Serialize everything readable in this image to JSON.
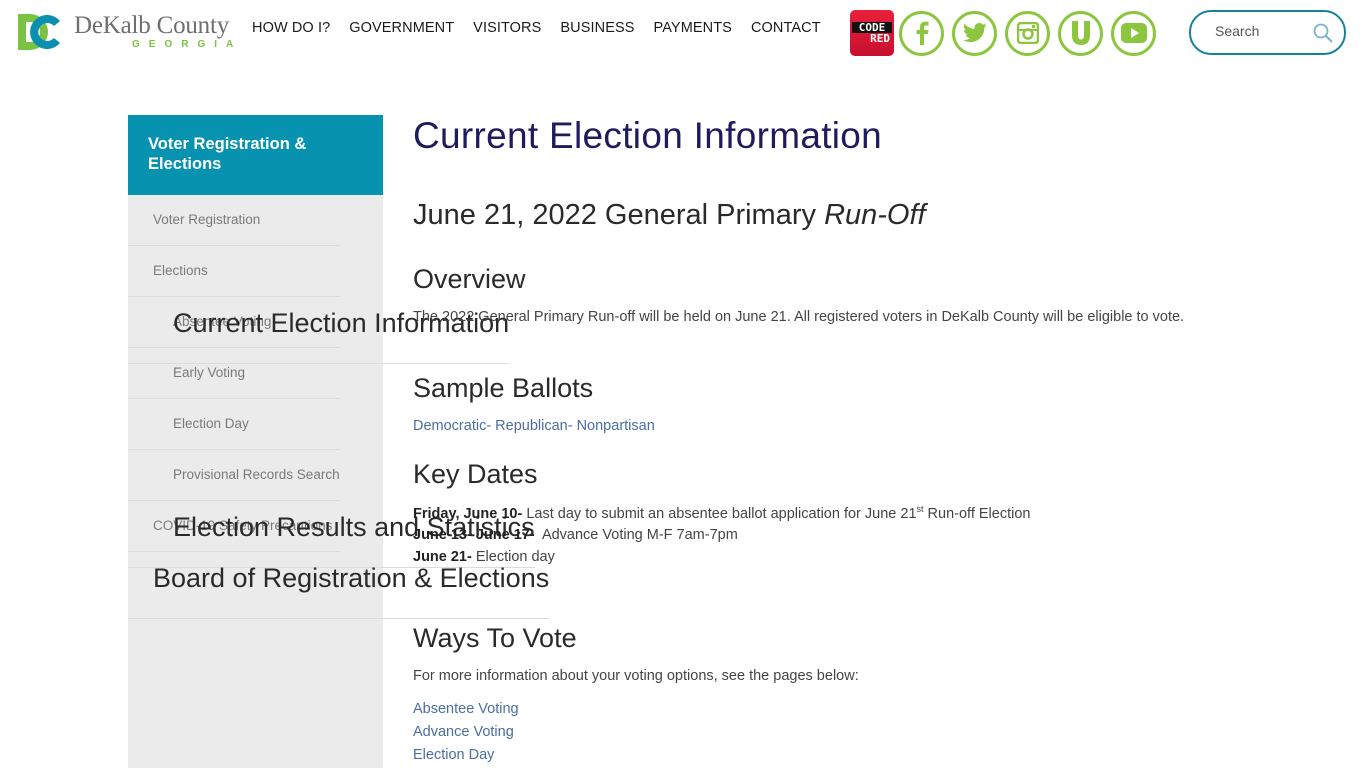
{
  "header": {
    "logo": {
      "name": "DeKalb County",
      "sub": "GEORGIA",
      "mark": "DC"
    },
    "nav": [
      "HOW DO I?",
      "GOVERNMENT",
      "VISITORS",
      "BUSINESS",
      "PAYMENTS",
      "CONTACT"
    ],
    "codered": {
      "top": "CODE",
      "bottom": "RED"
    },
    "social": [
      "facebook-icon",
      "twitter-icon",
      "instagram-icon",
      "u-icon",
      "youtube-icon"
    ],
    "search": {
      "placeholder": "Search",
      "value": ""
    }
  },
  "colors": {
    "brand_green": "#8cc63f",
    "brand_teal": "#0792b0",
    "title_navy": "#1f1c5e",
    "link_blue": "#4a6fa0"
  },
  "sidebar": {
    "heading": "Voter Registration & Elections",
    "items": [
      {
        "label": "Voter Registration",
        "level": 1
      },
      {
        "label": "Elections",
        "level": 1
      },
      {
        "label": "Current Election Information",
        "level": 2
      },
      {
        "label": "Absentee Voting",
        "level": 2
      },
      {
        "label": "Early Voting",
        "level": 2
      },
      {
        "label": "Election Day",
        "level": 2
      },
      {
        "label": "Provisional Records Search",
        "level": 2
      },
      {
        "label": "Election Results and Statistics",
        "level": 2
      },
      {
        "label": "COVID-19 Safety Precautions",
        "level": 1
      },
      {
        "label": "Board of Registration & Elections",
        "level": 1
      }
    ]
  },
  "main": {
    "title": "Current Election Information",
    "election_heading": {
      "text": "June 21, 2022 General Primary ",
      "emphasis": "Run-Off"
    },
    "overview": {
      "heading": "Overview",
      "text": "The 2022 General Primary Run-off  will be held on June 21. All registered voters in DeKalb County will be eligible to vote."
    },
    "sample_ballots": {
      "heading": "Sample Ballots",
      "link": "Democratic- Republican- Nonpartisan"
    },
    "key_dates": {
      "heading": "Key Dates",
      "items": [
        {
          "date": "Friday, June 10-",
          "text": " Last day to submit an absentee ballot application for June 21",
          "sup": "st",
          "after": " Run-off Election"
        },
        {
          "date": "June 13- June 17-",
          "text": "  Advance Voting M-F 7am-7pm",
          "sup": "",
          "after": ""
        },
        {
          "date": "June 21-",
          "text": " Election day",
          "sup": "",
          "after": ""
        }
      ]
    },
    "ways_to_vote": {
      "heading": "Ways To Vote",
      "intro": "For more information about your voting options, see the pages below:",
      "links": [
        "Absentee Voting",
        "Advance Voting",
        "Election Day"
      ]
    }
  }
}
